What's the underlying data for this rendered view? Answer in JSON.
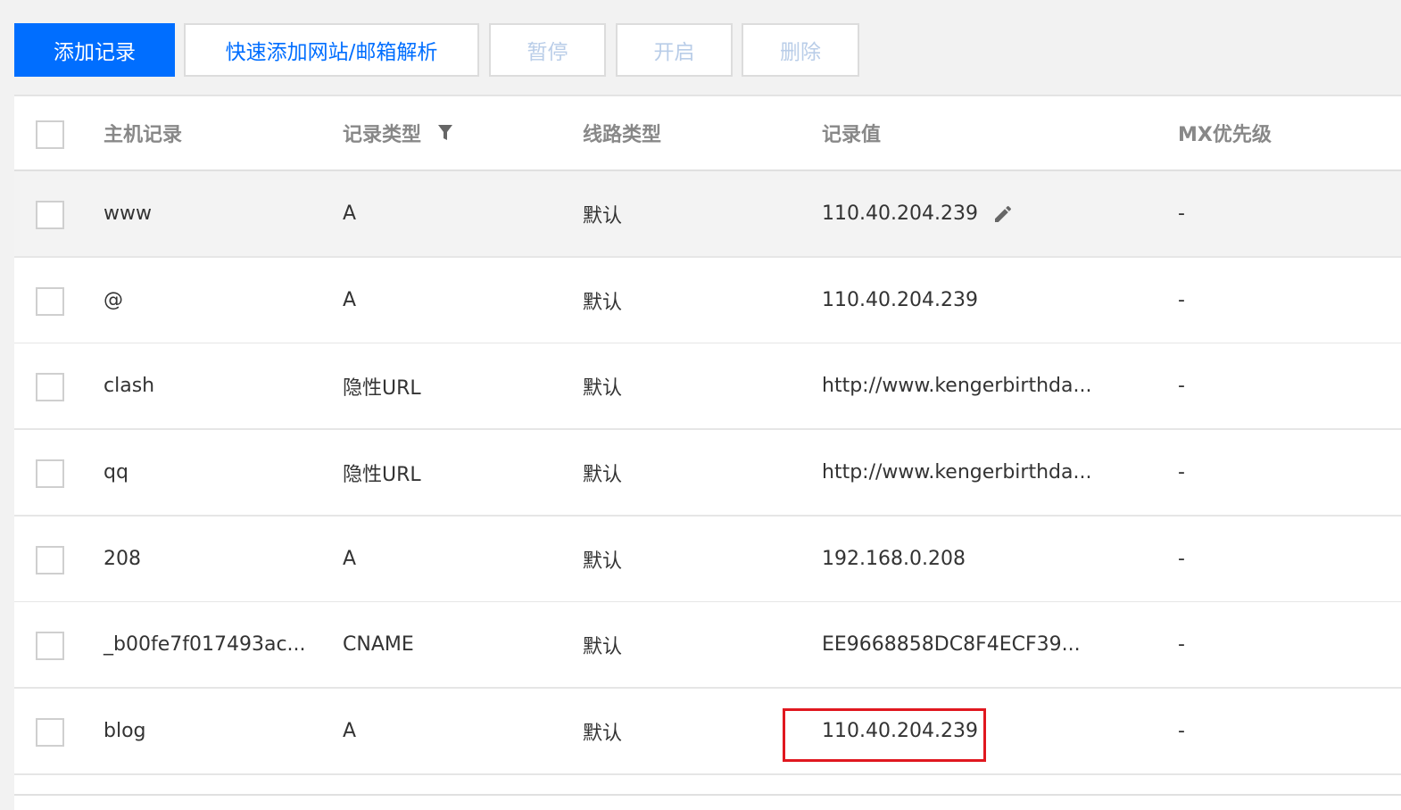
{
  "toolbar": {
    "add_record": "添加记录",
    "quick_add": "快速添加网站/邮箱解析",
    "pause": "暂停",
    "enable": "开启",
    "delete": "删除"
  },
  "table": {
    "columns": {
      "host": "主机记录",
      "type": "记录类型",
      "line": "线路类型",
      "value": "记录值",
      "mx": "MX优先级"
    },
    "rows": [
      {
        "host": "www",
        "type": "A",
        "line": "默认",
        "value": "110.40.204.239",
        "mx": "-"
      },
      {
        "host": "@",
        "type": "A",
        "line": "默认",
        "value": "110.40.204.239",
        "mx": "-"
      },
      {
        "host": "clash",
        "type": "隐性URL",
        "line": "默认",
        "value": "http://www.kengerbirthda...",
        "mx": "-"
      },
      {
        "host": "qq",
        "type": "隐性URL",
        "line": "默认",
        "value": "http://www.kengerbirthda...",
        "mx": "-"
      },
      {
        "host": "208",
        "type": "A",
        "line": "默认",
        "value": "192.168.0.208",
        "mx": "-"
      },
      {
        "host": "_b00fe7f017493ac...",
        "type": "CNAME",
        "line": "默认",
        "value": "EE9668858DC8F4ECF39...",
        "mx": "-"
      },
      {
        "host": "blog",
        "type": "A",
        "line": "默认",
        "value": "110.40.204.239",
        "mx": "-"
      }
    ]
  },
  "icons": {
    "filter": "filter-icon",
    "edit": "pencil-edit-icon"
  },
  "colors": {
    "primary": "#006eff",
    "highlight": "#e0181f",
    "disabled_text": "#b9cde8"
  }
}
